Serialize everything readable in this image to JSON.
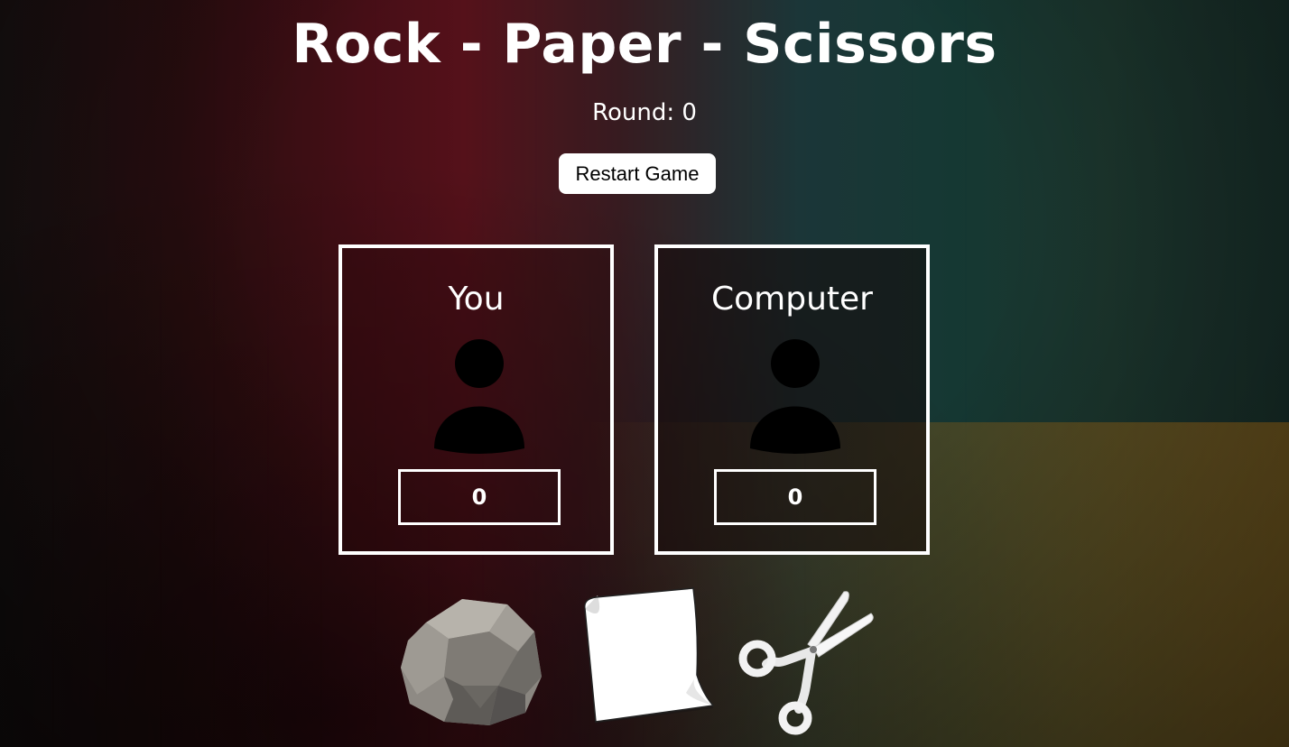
{
  "game": {
    "title": "Rock - Paper - Scissors",
    "round_text": "Round: 0",
    "restart_label": "Restart Game"
  },
  "players": [
    {
      "name": "You",
      "score": "0"
    },
    {
      "name": "Computer",
      "score": "0"
    }
  ],
  "choices": [
    {
      "name": "rock",
      "icon": "rock-icon"
    },
    {
      "name": "paper",
      "icon": "paper-icon"
    },
    {
      "name": "scissors",
      "icon": "scissors-icon"
    }
  ],
  "colors": {
    "text": "#ffffff",
    "button_bg": "#ffffff",
    "avatar": "#000000"
  }
}
